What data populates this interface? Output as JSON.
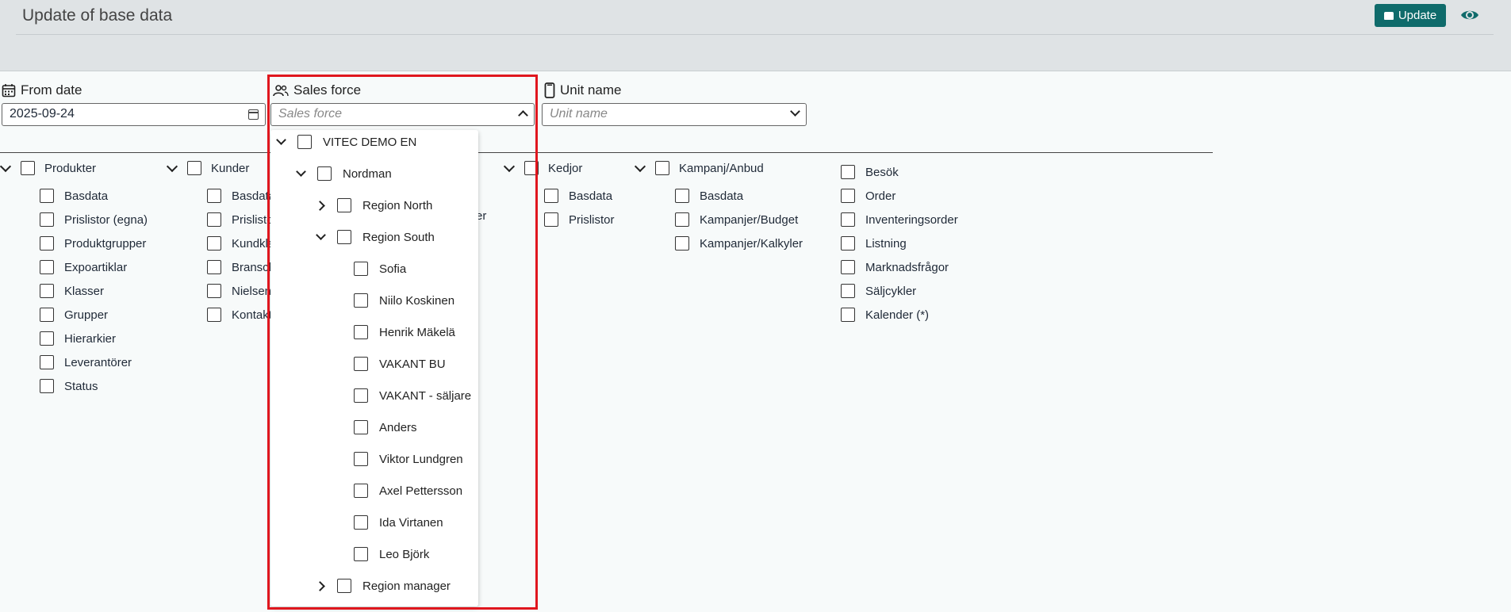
{
  "header": {
    "title": "Update of base data",
    "update_label": "Update"
  },
  "filters": {
    "from_date": {
      "label": "From date",
      "value": "2025-09-24"
    },
    "sales_force": {
      "label": "Sales force",
      "placeholder": "Sales force"
    },
    "unit_name": {
      "label": "Unit name",
      "placeholder": "Unit name"
    }
  },
  "groups": [
    {
      "title": "Produkter",
      "items": [
        "Basdata",
        "Prislistor (egna)",
        "Produktgrupper",
        "Expoartiklar",
        "Klasser",
        "Grupper",
        "Hierarkier",
        "Leverantörer",
        "Status"
      ]
    },
    {
      "title": "Kunder",
      "items": [
        "Basdata",
        "Prislistor",
        "Kundklasser",
        "Branscher",
        "Nielsen",
        "Kontakter"
      ]
    },
    {
      "title": "Kedjor",
      "items": [
        "Basdata",
        "Prislistor"
      ]
    },
    {
      "title": "Kampanj/Anbud",
      "items": [
        "Basdata",
        "Kampanjer/Budget",
        "Kampanjer/Kalkyler"
      ]
    },
    {
      "title": "",
      "items": [
        "Besök",
        "Order",
        "Inventeringsorder",
        "Listning",
        "Marknadsfrågor",
        "Säljcykler",
        "Kalender (*)"
      ]
    }
  ],
  "hidden_fragment": "er",
  "sales_force_tree": [
    {
      "label": "VITEC DEMO EN",
      "level": 0,
      "expand": "open"
    },
    {
      "label": "Nordman",
      "level": 1,
      "expand": "open"
    },
    {
      "label": "Region North",
      "level": 2,
      "expand": "closed"
    },
    {
      "label": "Region South",
      "level": 2,
      "expand": "open"
    },
    {
      "label": "Sofia",
      "level": 3,
      "expand": "none"
    },
    {
      "label": "Niilo Koskinen",
      "level": 3,
      "expand": "none"
    },
    {
      "label": "Henrik Mäkelä",
      "level": 3,
      "expand": "none"
    },
    {
      "label": "VAKANT BU",
      "level": 3,
      "expand": "none"
    },
    {
      "label": "VAKANT - säljare",
      "level": 3,
      "expand": "none"
    },
    {
      "label": "Anders",
      "level": 3,
      "expand": "none"
    },
    {
      "label": "Viktor Lundgren",
      "level": 3,
      "expand": "none"
    },
    {
      "label": "Axel Pettersson",
      "level": 3,
      "expand": "none"
    },
    {
      "label": "Ida Virtanen",
      "level": 3,
      "expand": "none"
    },
    {
      "label": "Leo Björk",
      "level": 3,
      "expand": "none"
    },
    {
      "label": "Region manager",
      "level": 2,
      "expand": "closed"
    }
  ],
  "colors": {
    "accent": "#0f6b6b",
    "highlight": "#e0161e",
    "header_bg": "#dfe3e5"
  }
}
